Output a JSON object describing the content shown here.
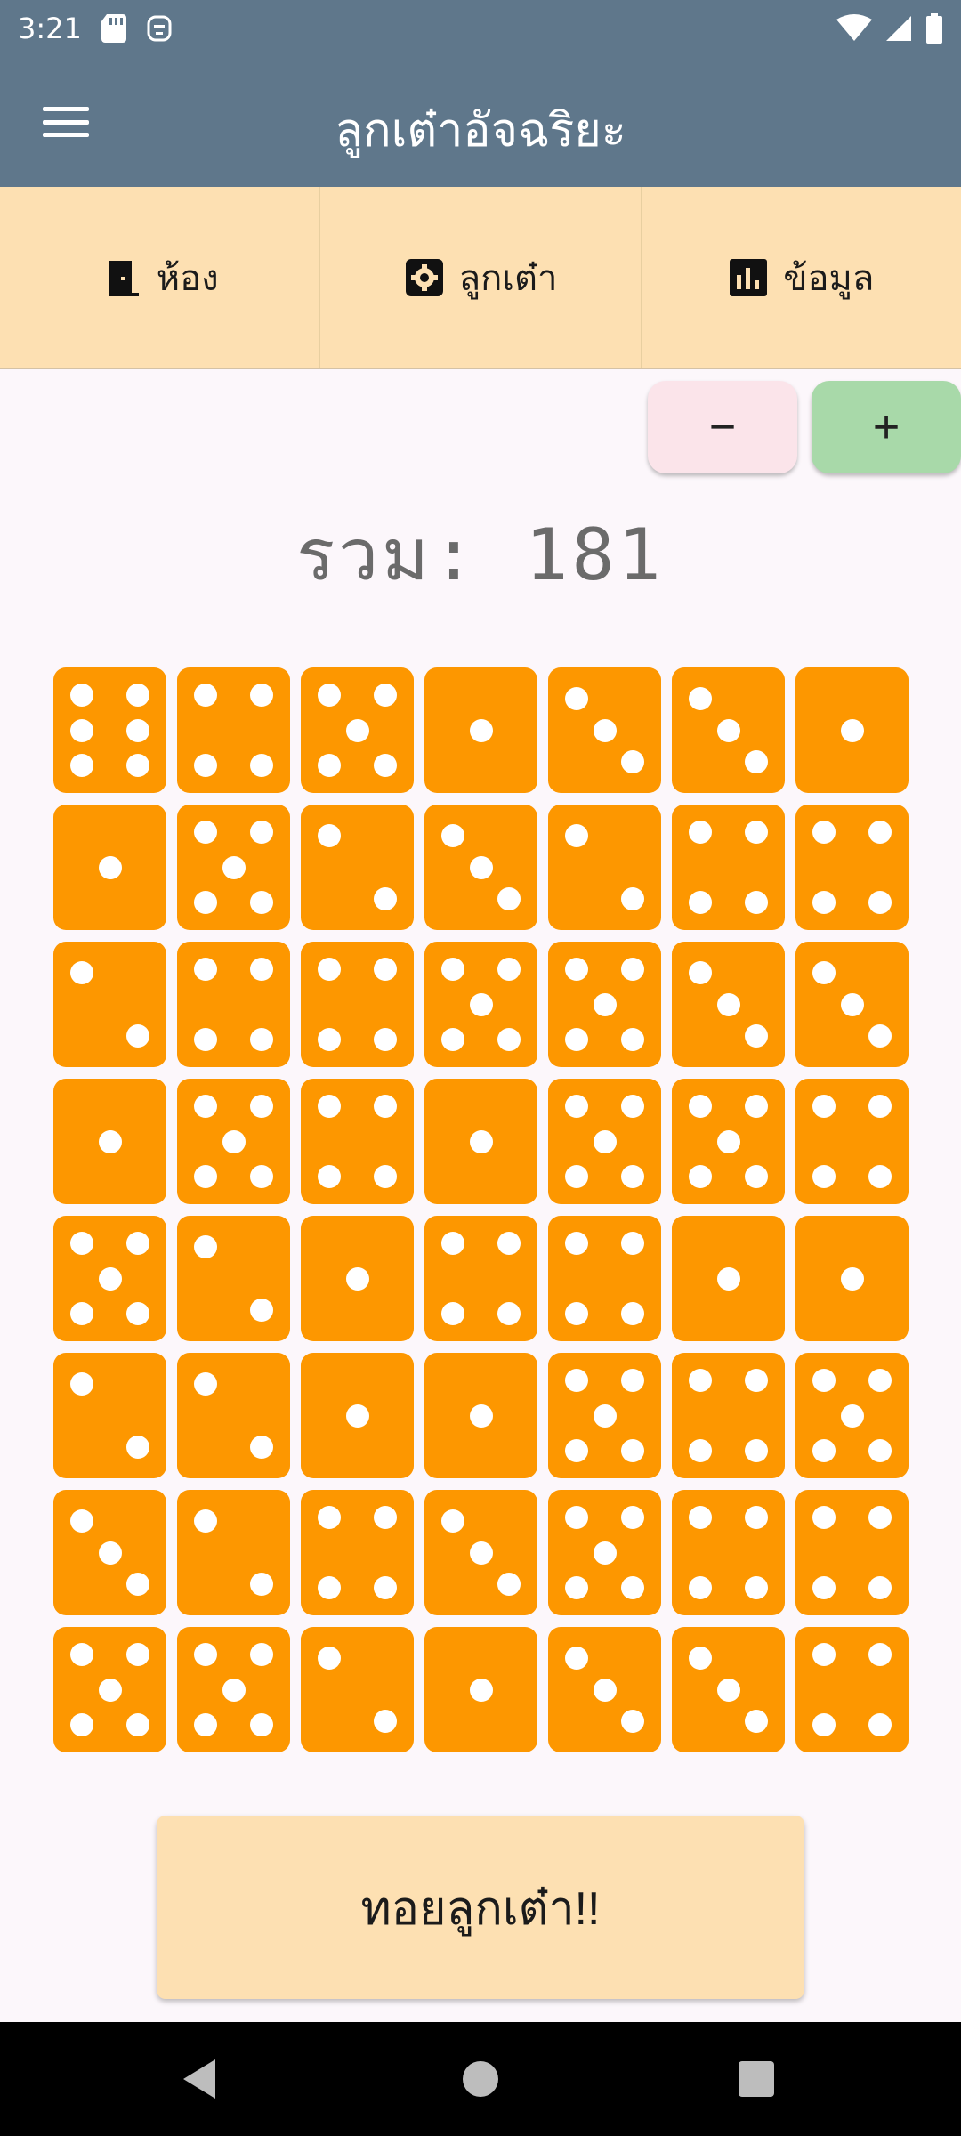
{
  "status": {
    "time": "3:21"
  },
  "app_bar": {
    "title": "ลูกเต๋าอัจฉริยะ"
  },
  "tabs": [
    {
      "label": "ห้อง",
      "icon": "door-icon"
    },
    {
      "label": "ลูกเต๋า",
      "icon": "gear-icon"
    },
    {
      "label": "ข้อมูล",
      "icon": "bar-chart-icon"
    }
  ],
  "stepper": {
    "minus_label": "−",
    "plus_label": "+"
  },
  "total": {
    "label": "รวม: 181"
  },
  "dice": [
    6,
    4,
    5,
    1,
    3,
    3,
    1,
    1,
    5,
    2,
    3,
    2,
    4,
    4,
    2,
    4,
    4,
    5,
    5,
    3,
    3,
    1,
    5,
    4,
    1,
    5,
    5,
    4,
    5,
    2,
    1,
    4,
    4,
    1,
    1,
    2,
    2,
    1,
    1,
    5,
    4,
    5,
    3,
    2,
    4,
    3,
    5,
    4,
    4,
    5,
    5,
    2,
    1,
    3,
    3,
    4
  ],
  "colors": {
    "die_face": "#fd9700",
    "pip": "#ffffff",
    "app_bar": "#5f778b",
    "tab_bar": "#fde0b2",
    "minus_button": "#fbe4ea",
    "plus_button": "#a8d9a9"
  },
  "roll_button": {
    "label": "ทอยลูกเต๋า!!"
  },
  "nav": {
    "back_icon": "back-triangle-icon",
    "home_icon": "home-circle-icon",
    "recent_icon": "recent-square-icon"
  }
}
